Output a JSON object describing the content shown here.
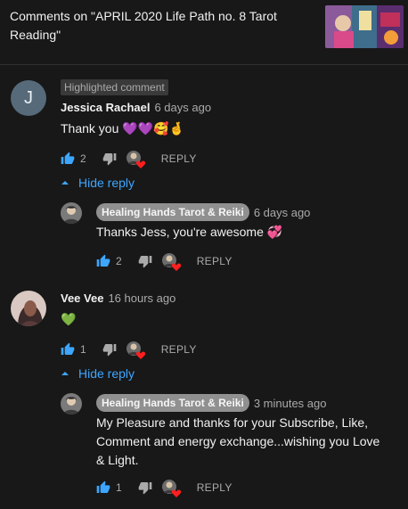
{
  "header": {
    "title": "Comments on \"APRIL 2020 Life Path no. 8 Tarot Reading\""
  },
  "comments": [
    {
      "highlight_label": "Highlighted comment",
      "avatar_letter": "J",
      "author": "Jessica Rachael",
      "time": "6 days ago",
      "text": "Thank you 💜💜🥰🤞",
      "likes": "2",
      "reply_label": "REPLY",
      "hide_replies_label": "Hide reply",
      "reply": {
        "author": "Healing Hands Tarot & Reiki",
        "time": "6 days ago",
        "text": "Thanks Jess, you're awesome 💞",
        "likes": "2",
        "reply_label": "REPLY"
      }
    },
    {
      "author": "Vee Vee",
      "time": "16 hours ago",
      "text": "💚",
      "likes": "1",
      "reply_label": "REPLY",
      "hide_replies_label": "Hide reply",
      "reply": {
        "author": "Healing Hands Tarot & Reiki",
        "time": "3 minutes ago",
        "text": "My Pleasure and thanks for your Subscribe, Like, Comment and  energy exchange...wishing you Love & Light.",
        "likes": "1",
        "reply_label": "REPLY"
      }
    }
  ],
  "colors": {
    "background": "#181818",
    "link": "#3ea6ff",
    "like_active": "#3ea6ff",
    "muted": "#aaaaaa"
  },
  "icons": {
    "like": "thumbs-up-icon",
    "dislike": "thumbs-down-icon",
    "creator_heart": "creator-heart-icon",
    "collapse": "chevron-up-icon"
  }
}
